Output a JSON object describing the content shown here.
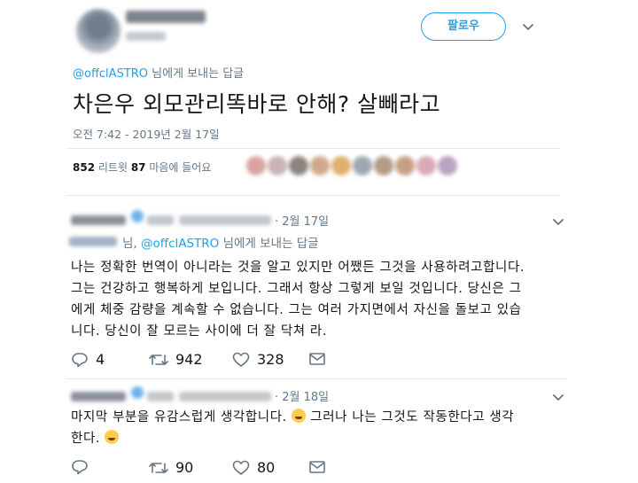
{
  "main_tweet": {
    "follow_label": "팔로우",
    "reply_prefix": "@offclASTRO",
    "reply_suffix": " 님에게 보내는 답글",
    "text": "차은우 외모관리똑바로 안해? 살빼라고",
    "timestamp": "오전 7:42 - 2019년 2월 17일",
    "retweet_count": "852",
    "retweet_label": " 리트윗  ",
    "like_count": "87",
    "like_label": " 마음에 들어요"
  },
  "replies": [
    {
      "date": "· 2월 17일",
      "reply_to_prefix": "님, ",
      "reply_to_mention": "@offclASTRO",
      "reply_to_suffix": " 님에게 보내는 답글",
      "lines": [
        "나는 정확한 번역이 아니라는 것을 알고 있지만 어쨌든 그것을 사용하려고합니다.",
        "그는 건강하고 행복하게 보입니다. 그래서 항상 그렇게 보일 것입니다. 당신은 그",
        "에게 체중 감량을 계속할 수 없습니다. 그는 여러 가지면에서 자신을 돌보고 있습",
        "니다. 당신이 잘 모르는 사이에 더 잘 닥쳐 라."
      ],
      "reply_count": "4",
      "retweet_count": "942",
      "like_count": "328"
    },
    {
      "date": "· 2월 18일",
      "line1_a": "마지막 부분을 유감스럽게 생각합니다. ",
      "line1_b": " 그러나 나는 그것도 작동한다고 생각",
      "line2": "한다. ",
      "reply_count": "",
      "retweet_count": "90",
      "like_count": "80"
    }
  ],
  "colors": {
    "accent": "#1da1f2",
    "muted": "#657786",
    "text": "#14171a",
    "divider": "#e6ecf0"
  },
  "icons": [
    "chevron-down-icon",
    "reply-icon",
    "retweet-icon",
    "heart-icon",
    "message-icon",
    "verified-icon",
    "emoji-icon"
  ]
}
